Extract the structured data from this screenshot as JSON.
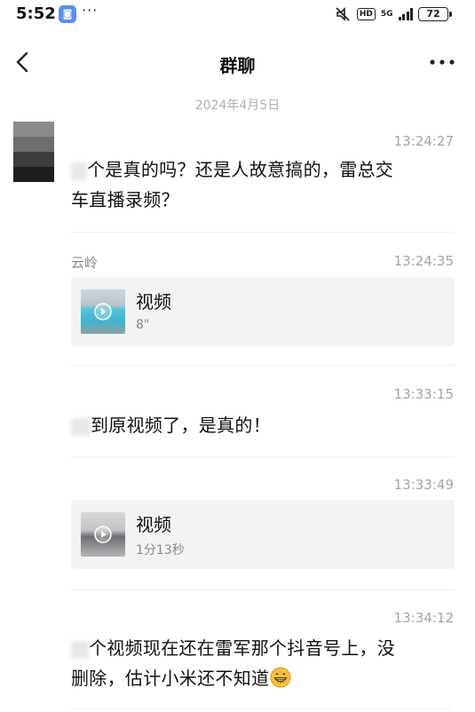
{
  "status_bar": {
    "time": "5:52",
    "app_icon": "message-app-icon",
    "more": "···",
    "network": "5G",
    "hd": "HD",
    "battery": "72"
  },
  "header": {
    "title": "群聊",
    "back_icon": "chevron-left-icon",
    "more_icon": "more-dots-icon"
  },
  "date_separator": "2024年4月5日",
  "messages": [
    {
      "time": "13:24:27",
      "text_prefix": "个是真的吗？还是人故意搞的，雷总交",
      "text_line2": "车直播录频？"
    },
    {
      "sender": "云岭",
      "time": "13:24:35",
      "video": {
        "label": "视频",
        "duration": "8\""
      }
    },
    {
      "time": "13:33:15",
      "text": "到原视频了，是真的！"
    },
    {
      "time": "13:33:49",
      "video": {
        "label": "视频",
        "duration": "1分13秒"
      }
    },
    {
      "time": "13:34:12",
      "text_line1": "个视频现在还在雷军那个抖音号上，没",
      "text_line2": "删除，估计小米还不知道"
    }
  ],
  "colors": {
    "timestamp": "#a3a3a3",
    "card_bg": "#f3f3f3",
    "date": "#b0b0b0"
  }
}
